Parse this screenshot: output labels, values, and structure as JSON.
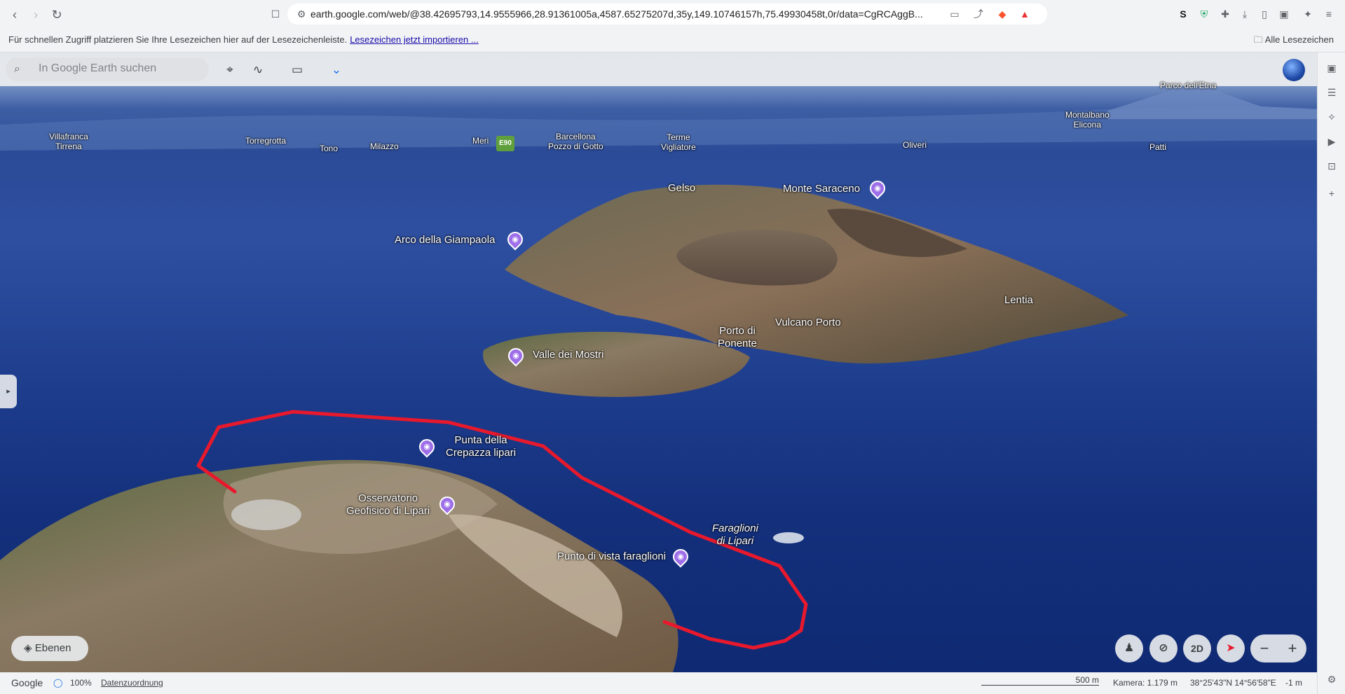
{
  "browser": {
    "url": "earth.google.com/web/@38.42695793,14.9555966,28.91361005a,4587.65275207d,35y,149.10746157h,75.49930458t,0r/data=CgRCAggB...",
    "bookmarks_hint": "Für schnellen Zugriff platzieren Sie Ihre Lesezeichen hier auf der Lesezeichenleiste.",
    "bookmarks_link": "Lesezeichen jetzt importieren ...",
    "all_bookmarks": "Alle Lesezeichen",
    "badge_count": "1"
  },
  "earth": {
    "search_placeholder": "In Google Earth suchen",
    "layers_label": "Ebenen",
    "view_2d": "2D",
    "road_shield": "E90"
  },
  "places": {
    "villafranca": "Villafranca\nTirrena",
    "torregrotta": "Torregrotta",
    "tono": "Tono",
    "milazzo": "Milazzo",
    "meri": "Meri",
    "barcellona": "Barcellona\nPozzo di Gotto",
    "terme": "Terme\nVigliatore",
    "oliveri": "Oliveri",
    "montalbano": "Montalbano\nElicona",
    "patti": "Patti",
    "parco": "Parco dell'Etna",
    "gelso": "Gelso",
    "monte_saraceno": "Monte Saraceno",
    "arco": "Arco della Giampaola",
    "lentia": "Lentia",
    "vulcano_porto": "Vulcano Porto",
    "porto_ponente": "Porto di\nPonente",
    "valle": "Valle dei Mostri",
    "punta": "Punta della\nCrepazza lipari",
    "osservatorio": "Osservatorio\nGeofisico di Lipari",
    "faraglioni": "Faraglioni\ndi Lipari",
    "punto_vista": "Punto di vista faraglioni"
  },
  "status": {
    "google": "Google",
    "percent": "100%",
    "attribution": "Datenzuordnung",
    "scale": "500 m",
    "camera": "Kamera: 1.179 m",
    "coords": "38°25'43\"N 14°56'58\"E",
    "elevation": "-1 m"
  },
  "colors": {
    "annotation_red": "#e8192c",
    "pin_purple": "#9d6ee8"
  }
}
